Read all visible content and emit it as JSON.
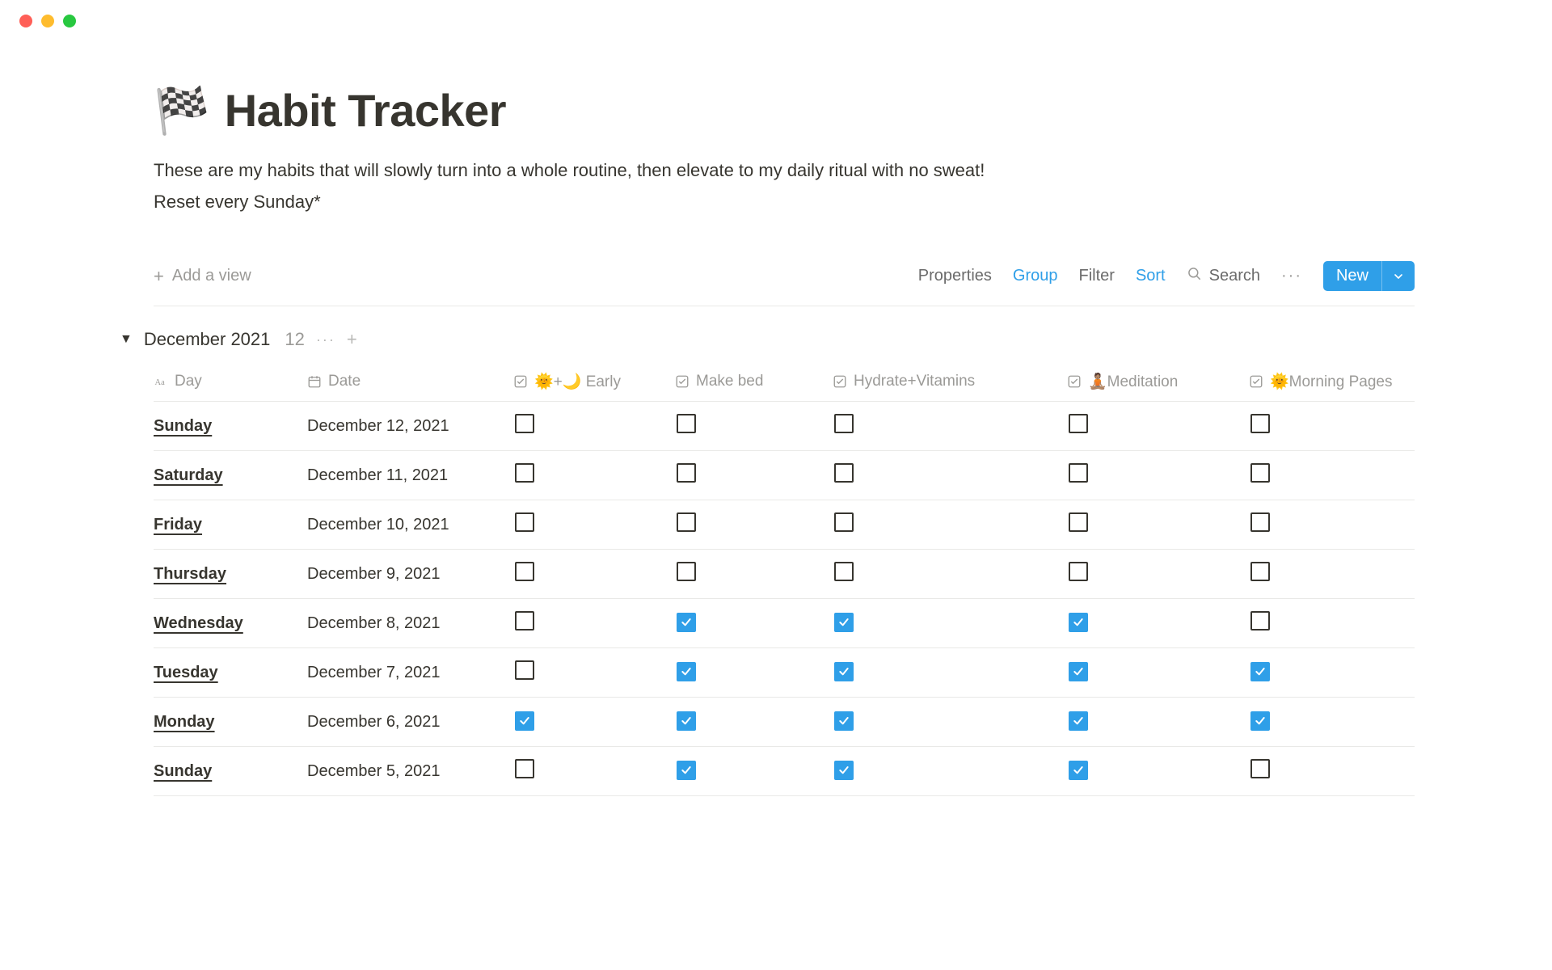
{
  "page": {
    "emoji": "🏁",
    "title": "Habit Tracker",
    "description": "These are my habits that will slowly turn into a whole routine, then elevate to my daily ritual with no sweat!",
    "reset_note": "Reset every Sunday*"
  },
  "toolbar": {
    "add_view": "Add a view",
    "properties": "Properties",
    "group": "Group",
    "filter": "Filter",
    "sort": "Sort",
    "search": "Search",
    "more": "···",
    "new": "New"
  },
  "group": {
    "name": "December 2021",
    "count": "12"
  },
  "columns": [
    {
      "key": "day",
      "label": "Day",
      "type": "title"
    },
    {
      "key": "date",
      "label": "Date",
      "type": "date"
    },
    {
      "key": "early",
      "label": "🌞+🌙 Early",
      "type": "checkbox"
    },
    {
      "key": "makebed",
      "label": "Make bed",
      "type": "checkbox"
    },
    {
      "key": "hydrate",
      "label": "Hydrate+Vitamins",
      "type": "checkbox"
    },
    {
      "key": "meditation",
      "label": "🧘🏽Meditation",
      "type": "checkbox"
    },
    {
      "key": "morningpages",
      "label": "🌞Morning Pages",
      "type": "checkbox"
    }
  ],
  "rows": [
    {
      "day": "Sunday",
      "date": "December 12, 2021",
      "early": false,
      "makebed": false,
      "hydrate": false,
      "meditation": false,
      "morningpages": false
    },
    {
      "day": "Saturday",
      "date": "December 11, 2021",
      "early": false,
      "makebed": false,
      "hydrate": false,
      "meditation": false,
      "morningpages": false
    },
    {
      "day": "Friday",
      "date": "December 10, 2021",
      "early": false,
      "makebed": false,
      "hydrate": false,
      "meditation": false,
      "morningpages": false
    },
    {
      "day": "Thursday",
      "date": "December 9, 2021",
      "early": false,
      "makebed": false,
      "hydrate": false,
      "meditation": false,
      "morningpages": false
    },
    {
      "day": "Wednesday",
      "date": "December 8, 2021",
      "early": false,
      "makebed": true,
      "hydrate": true,
      "meditation": true,
      "morningpages": false
    },
    {
      "day": "Tuesday",
      "date": "December 7, 2021",
      "early": false,
      "makebed": true,
      "hydrate": true,
      "meditation": true,
      "morningpages": true
    },
    {
      "day": "Monday",
      "date": "December 6, 2021",
      "early": true,
      "makebed": true,
      "hydrate": true,
      "meditation": true,
      "morningpages": true
    },
    {
      "day": "Sunday",
      "date": "December 5, 2021",
      "early": false,
      "makebed": true,
      "hydrate": true,
      "meditation": true,
      "morningpages": false
    }
  ]
}
